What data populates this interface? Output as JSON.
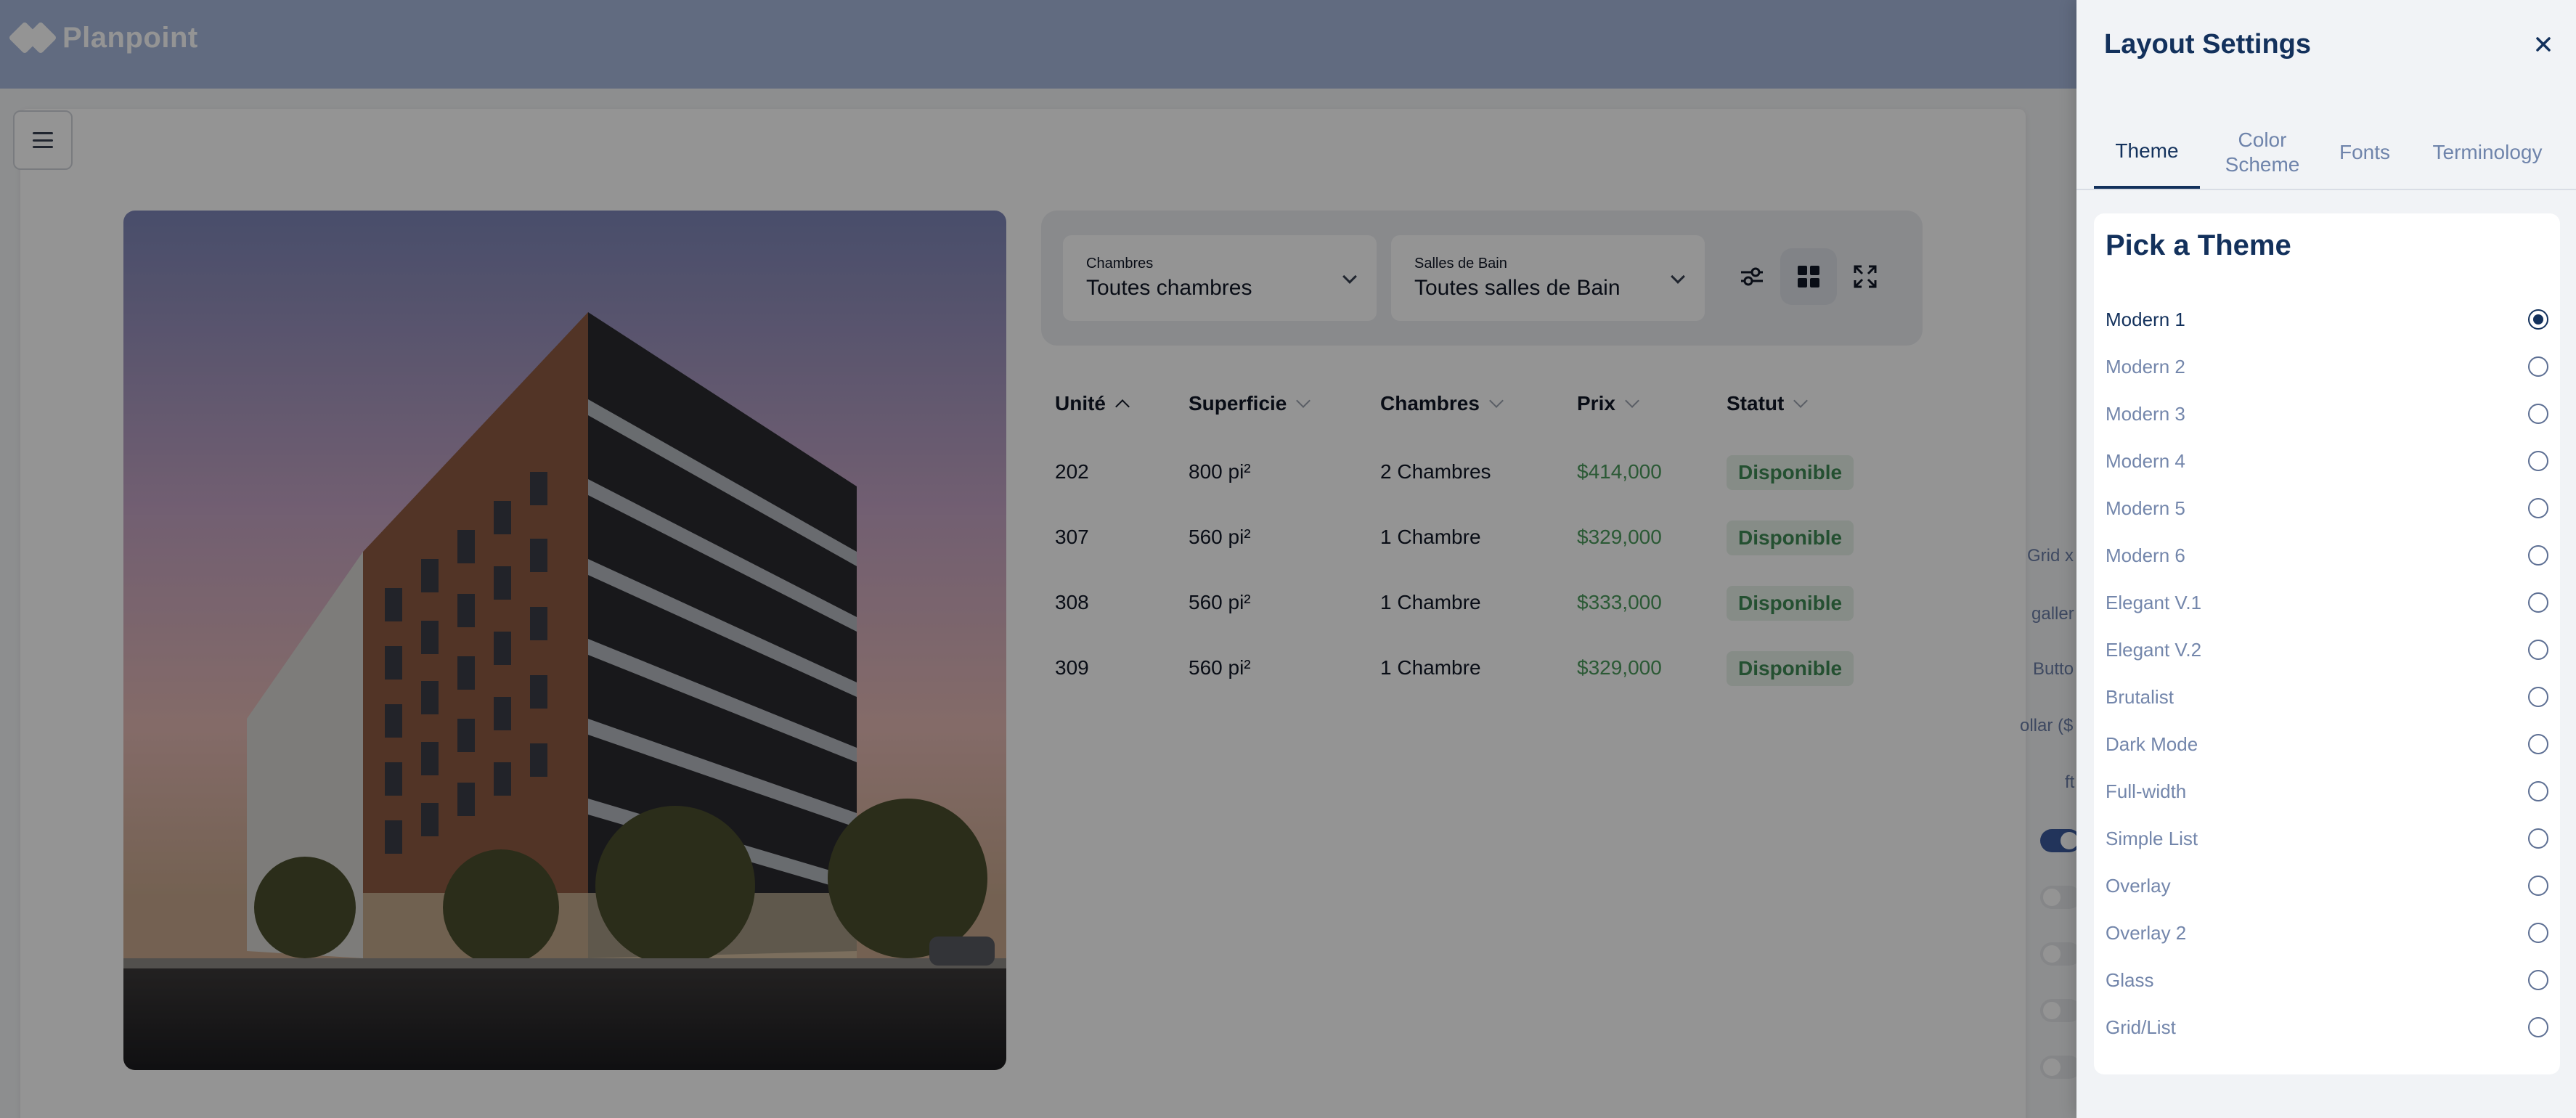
{
  "app": {
    "brand": "Planpoint"
  },
  "filters": {
    "bedrooms": {
      "label": "Chambres",
      "value": "Toutes chambres"
    },
    "bathrooms": {
      "label": "Salles de Bain",
      "value": "Toutes salles de Bain"
    },
    "icons": [
      "sliders-icon",
      "grid-icon",
      "expand-icon"
    ]
  },
  "table": {
    "headers": [
      "Unité",
      "Superficie",
      "Chambres",
      "Prix",
      "Statut"
    ],
    "rows": [
      {
        "unit": "202",
        "area": "800 pi²",
        "rooms": "2 Chambres",
        "price": "$414,000",
        "status": "Disponible"
      },
      {
        "unit": "307",
        "area": "560 pi²",
        "rooms": "1 Chambre",
        "price": "$329,000",
        "status": "Disponible"
      },
      {
        "unit": "308",
        "area": "560 pi²",
        "rooms": "1 Chambre",
        "price": "$333,000",
        "status": "Disponible"
      },
      {
        "unit": "309",
        "area": "560 pi²",
        "rooms": "1 Chambre",
        "price": "$329,000",
        "status": "Disponible"
      }
    ]
  },
  "background_panel": {
    "fragments": [
      "Grid x",
      "galler",
      "Butto",
      "ollar ($",
      "ft"
    ]
  },
  "settings": {
    "title": "Layout Settings",
    "tabs": [
      "Theme",
      "Color Scheme",
      "Fonts",
      "Terminology"
    ],
    "active_tab": "Theme",
    "section_title": "Pick a Theme",
    "selected_theme": "Modern 1",
    "themes": [
      "Modern 1",
      "Modern 2",
      "Modern 3",
      "Modern 4",
      "Modern 5",
      "Modern 6",
      "Elegant V.1",
      "Elegant V.2",
      "Brutalist",
      "Dark Mode",
      "Full-width",
      "Simple List",
      "Overlay",
      "Overlay 2",
      "Glass",
      "Grid/List"
    ]
  },
  "colors": {
    "topbar": "#a7b8dd",
    "accent_navy": "#13315c",
    "price_green": "#4a9a5c",
    "muted_blue": "#7386ab"
  }
}
